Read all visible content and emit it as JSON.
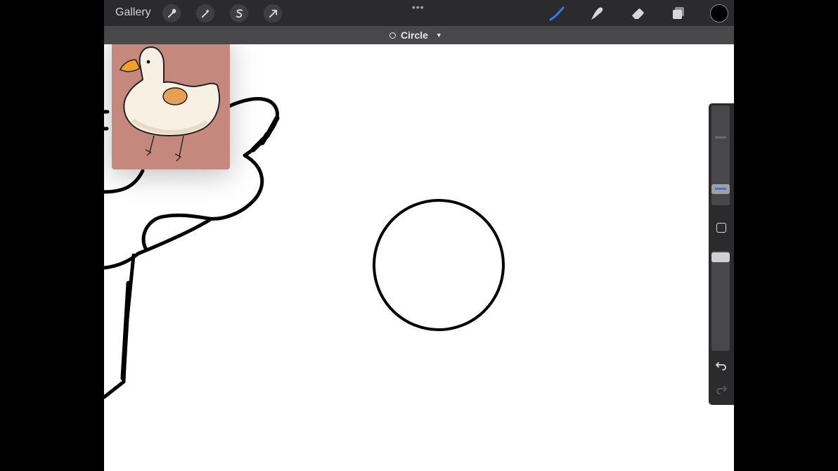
{
  "topbar": {
    "gallery_label": "Gallery",
    "menu_dots": "•••",
    "tools": [
      "wrench-icon",
      "magic-wand-icon",
      "selection-icon",
      "transform-arrow-icon"
    ],
    "right_tools": [
      "brush-icon",
      "smudge-icon",
      "eraser-icon",
      "layers-icon"
    ],
    "active_tool": "brush",
    "accent_color": "#2f7cf6",
    "current_color": "#000000"
  },
  "shape_bar": {
    "shape_label": "Circle",
    "shape_icon": "circle-outline-icon",
    "dropdown_icon": "caret-down-icon"
  },
  "reference_window": {
    "subject": "duck illustration",
    "background_color": "#c4897c"
  },
  "sidebar": {
    "size_slider_icon": "slider-thumb",
    "modify_button_icon": "square-icon",
    "opacity_slider_icon": "slider-thumb",
    "undo_icon": "undo-icon",
    "redo_icon": "redo-icon"
  }
}
